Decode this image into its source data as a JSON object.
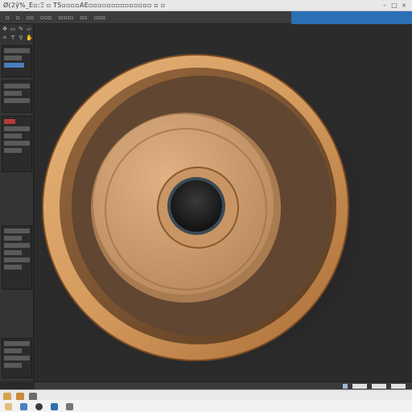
{
  "window": {
    "title": "Ø(2ŷ%_É▫:Ξ  ▫  ΤS▫▫▫▫ΑΕ▫▫▫▫▫▫▫▫▫▫▫▫▫▫ ▫  ▫"
  },
  "menubar": {
    "items": [
      "▫",
      "▫",
      "▫▫",
      "▫▫▫",
      "▫▫▫▫",
      "▫▫",
      "▫▫▫"
    ]
  },
  "colors": {
    "accent": "#2b6fb5",
    "wood_light": "#d9a56a",
    "wood_dark": "#8a5a2e",
    "cork": "#c79a6e",
    "canvas_bg": "#2b2b2b"
  },
  "icons": {
    "window_controls": [
      "minimize-icon",
      "maximize-icon",
      "close-icon"
    ],
    "tools": [
      "move-tool-icon",
      "select-tool-icon",
      "brush-tool-icon",
      "eraser-tool-icon",
      "crop-tool-icon",
      "text-tool-icon",
      "zoom-tool-icon",
      "hand-tool-icon"
    ],
    "taskbar": [
      "start-icon",
      "folder-icon",
      "browser-icon",
      "app-icon",
      "settings-icon",
      "mail-icon"
    ]
  }
}
